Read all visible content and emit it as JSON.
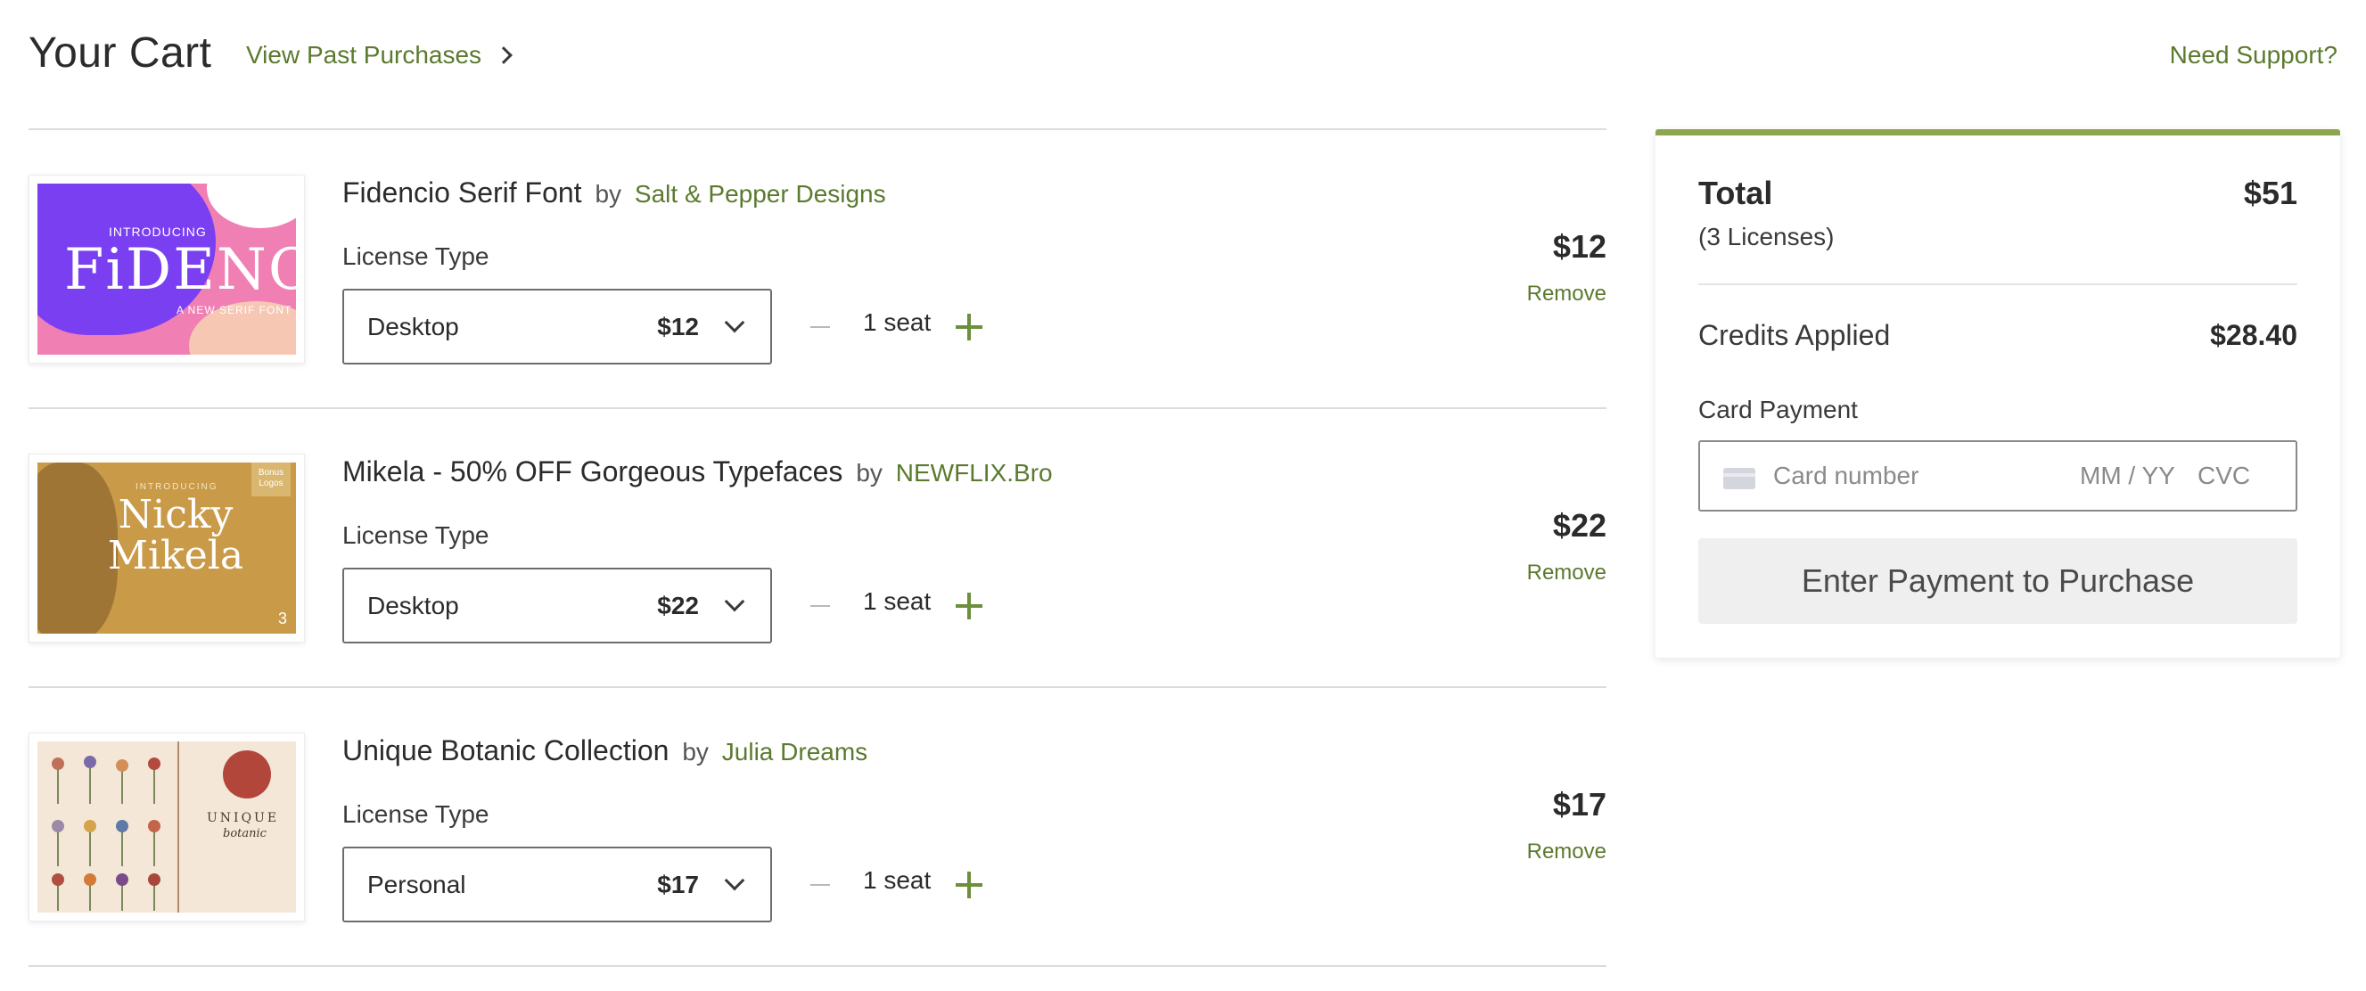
{
  "header": {
    "title": "Your Cart",
    "past_purchases_label": "View Past Purchases",
    "support_label": "Need Support?"
  },
  "cart": {
    "items": [
      {
        "title": "Fidencio Serif Font",
        "by": "by",
        "author": "Salt & Pepper Designs",
        "license_label": "License Type",
        "license_value": "Desktop",
        "license_price": "$12",
        "seats": "1 seat",
        "price": "$12",
        "remove_label": "Remove",
        "thumb": {
          "line1": "INTRODUCING",
          "line2": "FiDENCiO",
          "line3": "A NEW SERIF FONT"
        }
      },
      {
        "title": "Mikela - 50% OFF Gorgeous Typefaces",
        "by": "by",
        "author": "NEWFLIX.Bro",
        "license_label": "License Type",
        "license_value": "Desktop",
        "license_price": "$22",
        "seats": "1 seat",
        "price": "$22",
        "remove_label": "Remove",
        "thumb": {
          "line1": "INTRODUCING",
          "line2": "Nicky Mikela",
          "ribbon": "Bonus Logos",
          "badge": "3"
        }
      },
      {
        "title": "Unique Botanic Collection",
        "by": "by",
        "author": "Julia Dreams",
        "license_label": "License Type",
        "license_value": "Personal",
        "license_price": "$17",
        "seats": "1 seat",
        "price": "$17",
        "remove_label": "Remove",
        "thumb": {
          "line1": "UNIQUE",
          "line2": "botanic"
        }
      }
    ]
  },
  "summary": {
    "total_label": "Total",
    "total_value": "$51",
    "licenses": "(3 Licenses)",
    "credits_label": "Credits Applied",
    "credits_value": "$28.40",
    "card_label": "Card Payment",
    "card_number_placeholder": "Card number",
    "card_exp_placeholder": "MM / YY",
    "card_cvc_placeholder": "CVC",
    "pay_button_label": "Enter Payment to Purchase"
  },
  "colors": {
    "accent_green": "#5b7a2e",
    "summary_bar": "#8ba64e"
  },
  "icons": [
    "chevron-right-icon",
    "chevron-down-icon",
    "minus-icon",
    "plus-icon",
    "credit-card-icon"
  ]
}
